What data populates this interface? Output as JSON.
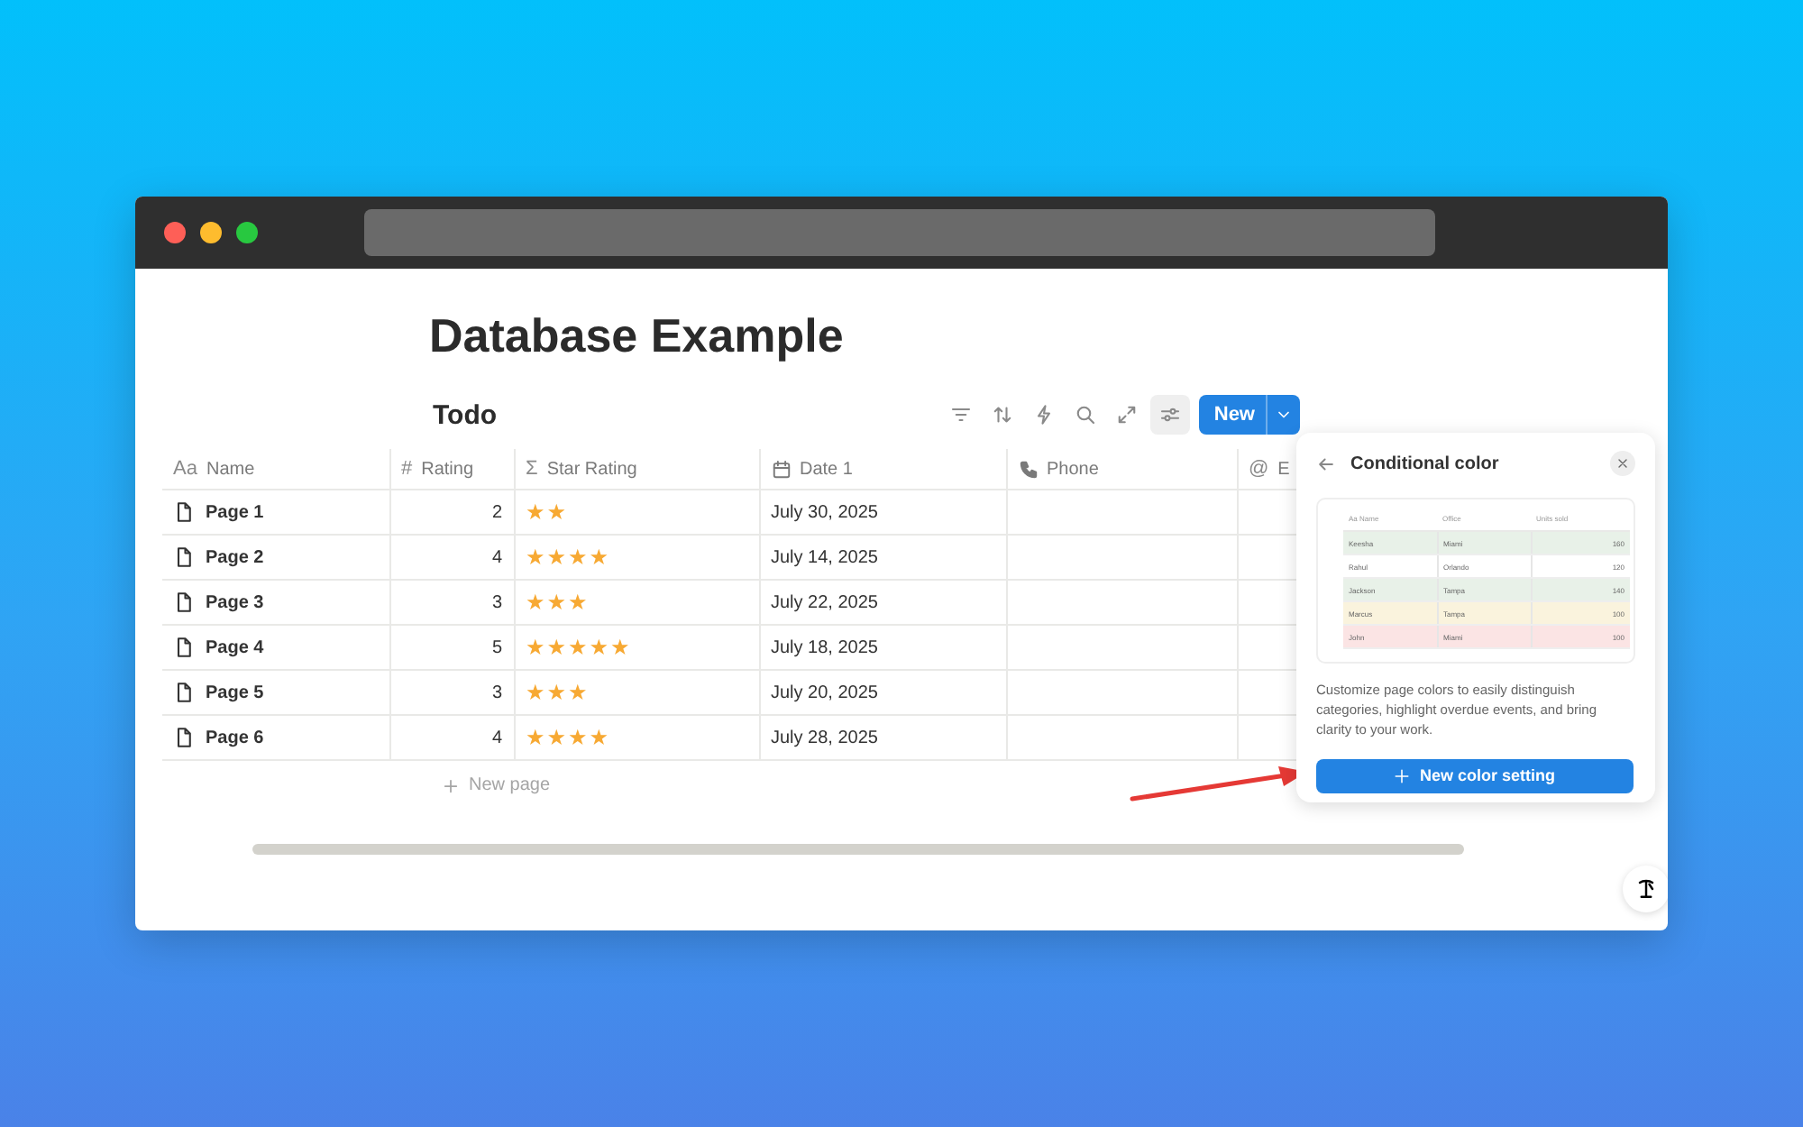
{
  "page": {
    "title": "Database Example"
  },
  "view": {
    "title": "Todo",
    "new_button": "New"
  },
  "toolbar": [
    {
      "kind": "filter",
      "selected": false
    },
    {
      "kind": "sort",
      "selected": false
    },
    {
      "kind": "automation",
      "selected": false
    },
    {
      "kind": "search",
      "selected": false
    },
    {
      "kind": "expand",
      "selected": false
    },
    {
      "kind": "settings",
      "selected": true
    }
  ],
  "table": {
    "columns": [
      {
        "label": "Name",
        "kind": "text",
        "glyph": "Aa"
      },
      {
        "label": "Rating",
        "kind": "number",
        "glyph": "#"
      },
      {
        "label": "Star Rating",
        "kind": "formula",
        "glyph": "Σ"
      },
      {
        "label": "Date 1",
        "kind": "date"
      },
      {
        "label": "Phone",
        "kind": "phone"
      },
      {
        "label": "E",
        "kind": "email",
        "glyph": "@"
      }
    ],
    "rows": [
      {
        "name": "Page 1",
        "rating": "2",
        "star_rating": "★★",
        "date": "July 30, 2025"
      },
      {
        "name": "Page 2",
        "rating": "4",
        "star_rating": "★★★★",
        "date": "July 14, 2025"
      },
      {
        "name": "Page 3",
        "rating": "3",
        "star_rating": "★★★",
        "date": "July 22, 2025"
      },
      {
        "name": "Page 4",
        "rating": "5",
        "star_rating": "★★★★★",
        "date": "July 18, 2025"
      },
      {
        "name": "Page 5",
        "rating": "3",
        "star_rating": "★★★",
        "date": "July 20, 2025"
      },
      {
        "name": "Page 6",
        "rating": "4",
        "star_rating": "★★★★",
        "date": "July 28, 2025"
      }
    ],
    "new_row": "New page"
  },
  "popup": {
    "title": "Conditional color",
    "preview": {
      "columns": [
        {
          "label": "Name",
          "glyph": "Aa"
        },
        {
          "label": "Office"
        },
        {
          "label": "Units sold"
        }
      ],
      "rows": [
        {
          "cells": [
            "Keesha",
            "Miami",
            "160"
          ],
          "color": "#e8f1e8"
        },
        {
          "cells": [
            "Rahul",
            "Orlando",
            "120"
          ],
          "color": "#ffffff"
        },
        {
          "cells": [
            "Jackson",
            "Tampa",
            "140"
          ],
          "color": "#e8f1e8"
        },
        {
          "cells": [
            "Marcus",
            "Tampa",
            "100"
          ],
          "color": "#faf3dd"
        },
        {
          "cells": [
            "John",
            "Miami",
            "100"
          ],
          "color": "#fbe4e4"
        }
      ]
    },
    "description": "Customize page colors to easily distinguish categories, highlight overdue events, and bring clarity to your work.",
    "button": "New color setting"
  }
}
